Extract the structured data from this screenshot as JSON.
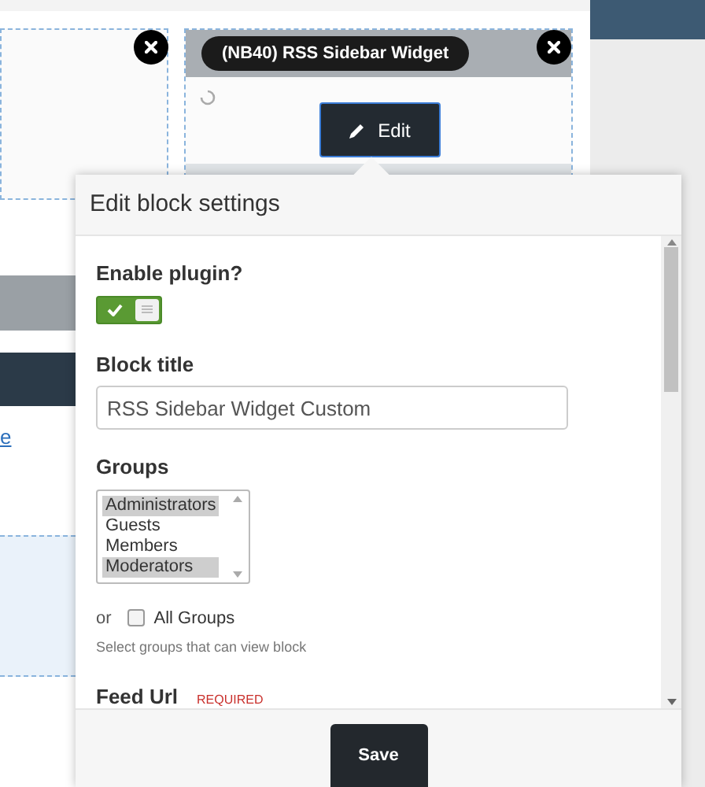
{
  "widget_block": {
    "title": "(NB40) RSS Sidebar Widget",
    "edit_button": "Edit"
  },
  "background": {
    "link_fragment": "e"
  },
  "dialog": {
    "title": "Edit block settings",
    "fields": [
      {
        "kind": "toggle",
        "label": "Enable plugin?",
        "on": true
      },
      {
        "kind": "text",
        "label": "Block title",
        "value": "RSS Sidebar Widget Custom"
      },
      {
        "kind": "multiselect",
        "label": "Groups",
        "options": [
          {
            "label": "Administrators",
            "selected": true
          },
          {
            "label": "Guests",
            "selected": false
          },
          {
            "label": "Members",
            "selected": false
          },
          {
            "label": "Moderators",
            "selected": true
          }
        ],
        "or_text": "or",
        "all_option": {
          "label": "All Groups",
          "checked": false
        },
        "help": "Select groups that can view block"
      },
      {
        "kind": "heading",
        "label": "Feed Url",
        "required": "REQUIRED"
      }
    ],
    "save_button": "Save"
  }
}
